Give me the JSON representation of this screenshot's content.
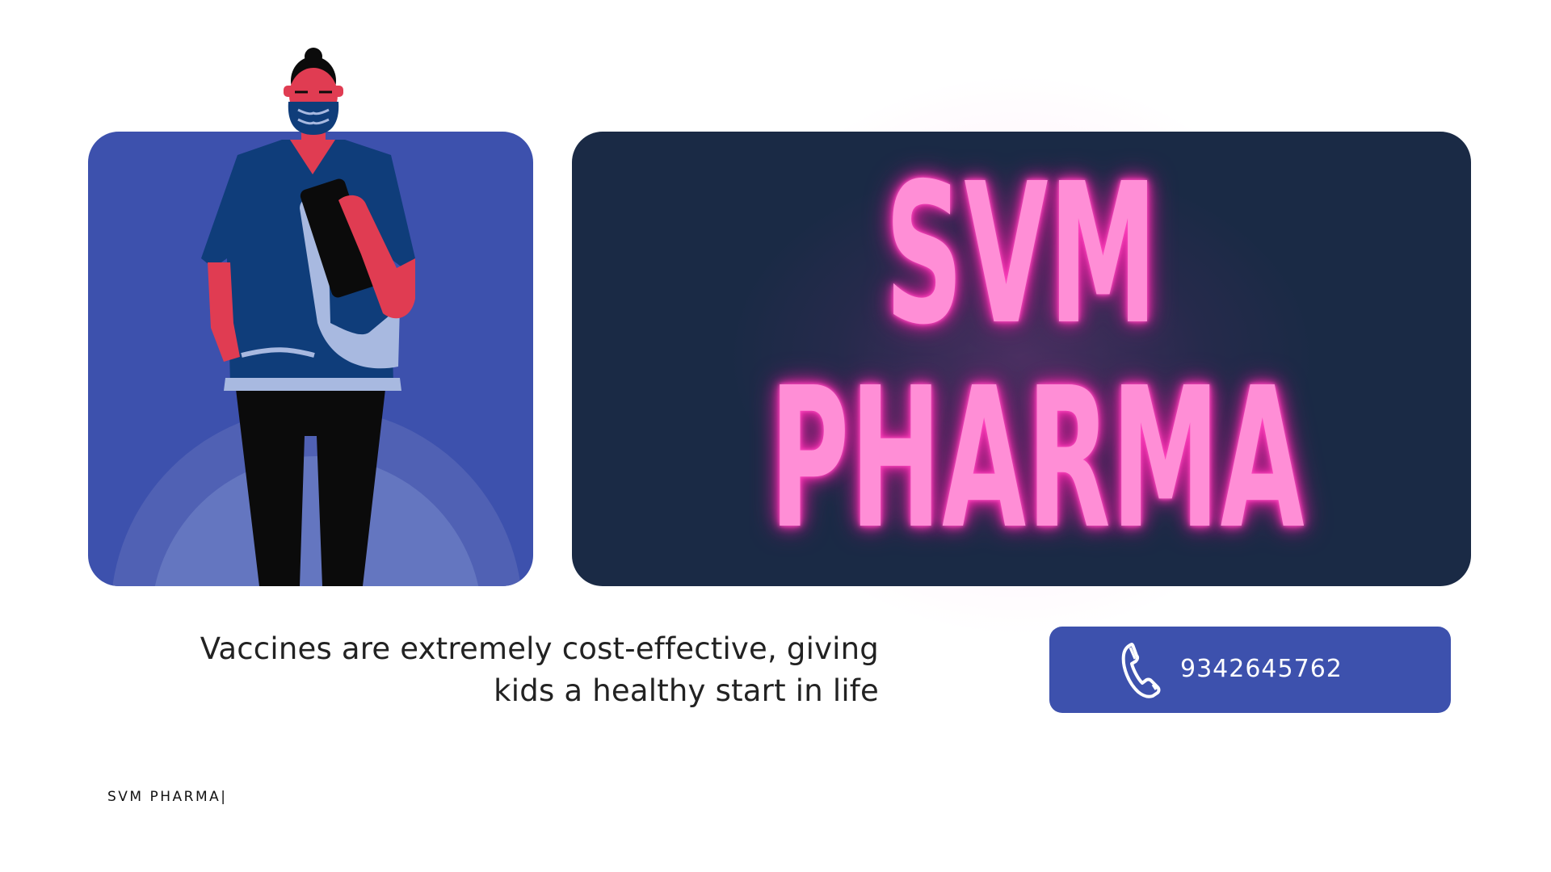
{
  "brand": {
    "line1": "SVM",
    "line2": "PHARMA"
  },
  "tagline": {
    "line1": "Vaccines are extremely cost-effective, giving",
    "line2": "kids a healthy start in life"
  },
  "contact": {
    "phone": "9342645762",
    "icon": "phone-icon"
  },
  "footer": {
    "brand": "SVM PHARMA|"
  },
  "illustration": {
    "icon": "nurse-illustration"
  },
  "colors": {
    "card_blue": "#3d51ad",
    "card_navy": "#1a2a45",
    "neon_pink": "#ff8ed6",
    "skin_red": "#e03c52",
    "scrubs_navy": "#0f3d7a",
    "pants_black": "#0b0b0b",
    "clipboard_light": "#a8b9e0"
  }
}
